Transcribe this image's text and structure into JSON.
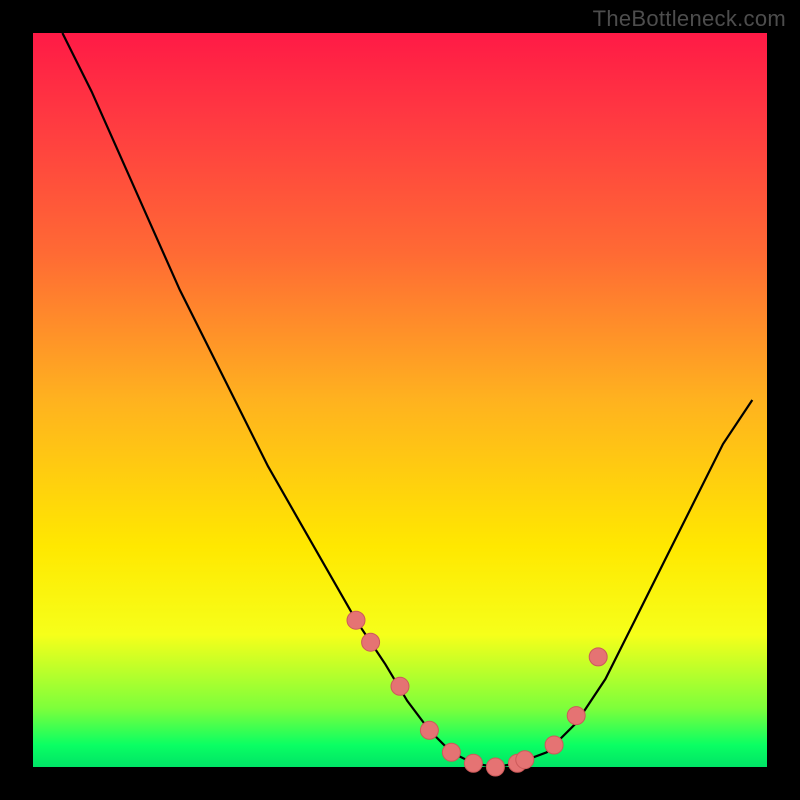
{
  "watermark": "TheBottleneck.com",
  "colors": {
    "background": "#000000",
    "curve": "#000000",
    "marker_fill": "#e57373",
    "marker_stroke": "#cc5a5a",
    "gradient_stops": [
      "#ff1a46",
      "#ff6a34",
      "#ffe800",
      "#0aff63"
    ]
  },
  "chart_data": {
    "type": "line",
    "title": "",
    "xlabel": "",
    "ylabel": "",
    "xlim": [
      0,
      100
    ],
    "ylim": [
      0,
      100
    ],
    "series": [
      {
        "name": "bottleneck-curve",
        "x": [
          4,
          8,
          12,
          16,
          20,
          24,
          28,
          32,
          36,
          40,
          44,
          48,
          51,
          54,
          57,
          60,
          63,
          66,
          70,
          74,
          78,
          82,
          86,
          90,
          94,
          98
        ],
        "y": [
          100,
          92,
          83,
          74,
          65,
          57,
          49,
          41,
          34,
          27,
          20,
          14,
          9,
          5,
          2,
          0.5,
          0,
          0.5,
          2,
          6,
          12,
          20,
          28,
          36,
          44,
          50
        ]
      }
    ],
    "markers": {
      "name": "highlighted-points",
      "x": [
        44,
        46,
        50,
        54,
        57,
        60,
        63,
        66,
        67,
        71,
        74,
        77
      ],
      "y": [
        20,
        17,
        11,
        5,
        2,
        0.5,
        0,
        0.5,
        1,
        3,
        7,
        15
      ]
    }
  }
}
